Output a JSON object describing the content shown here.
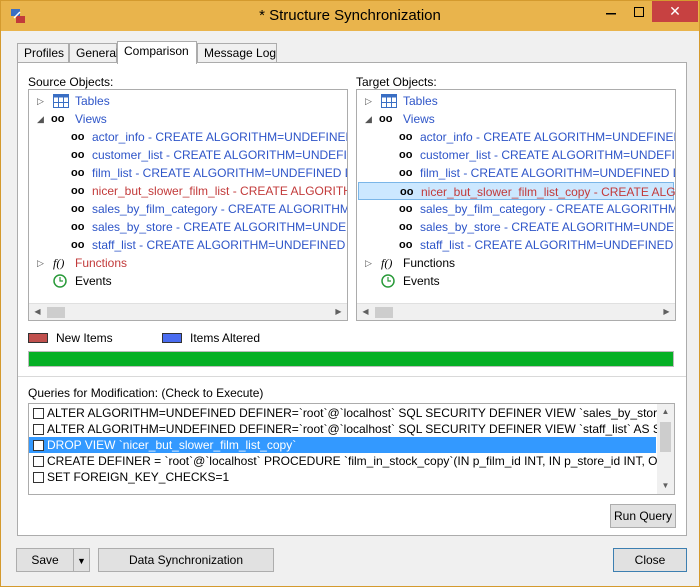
{
  "window": {
    "title": "* Structure Synchronization"
  },
  "tabs": [
    {
      "label": "Profiles"
    },
    {
      "label": "General"
    },
    {
      "label": "Comparison"
    },
    {
      "label": "Message Log"
    }
  ],
  "source": {
    "label": "Source Objects:",
    "tables": "Tables",
    "views": "Views",
    "items": [
      "actor_info - CREATE ALGORITHM=UNDEFINED DEFINER",
      "customer_list - CREATE ALGORITHM=UNDEFINED DEFINER",
      "film_list - CREATE ALGORITHM=UNDEFINED DEFINER",
      "nicer_but_slower_film_list - CREATE ALGORITHM=UNDEFINED",
      "sales_by_film_category - CREATE ALGORITHM=UNDEFINED",
      "sales_by_store - CREATE ALGORITHM=UNDEFINED DEFINER",
      "staff_list - CREATE ALGORITHM=UNDEFINED DEFINER"
    ],
    "functions": "Functions",
    "events": "Events"
  },
  "target": {
    "label": "Target Objects:",
    "tables": "Tables",
    "views": "Views",
    "items": [
      "actor_info - CREATE ALGORITHM=UNDEFINED DEFINER",
      "customer_list - CREATE ALGORITHM=UNDEFINED DEFINER",
      "film_list - CREATE ALGORITHM=UNDEFINED DEFINER",
      "nicer_but_slower_film_list_copy - CREATE ALGORITHM",
      "sales_by_film_category - CREATE ALGORITHM=UNDEFINED",
      "sales_by_store - CREATE ALGORITHM=UNDEFINED DEFINER",
      "staff_list - CREATE ALGORITHM=UNDEFINED DEFINER"
    ],
    "functions": "Functions",
    "events": "Events"
  },
  "legend": {
    "new_items": "New Items",
    "items_altered": "Items Altered",
    "new_color": "#c0504d",
    "altered_color": "#4a6cf0"
  },
  "progress": {
    "value": 1.0
  },
  "queries": {
    "label": "Queries for Modification: (Check to Execute)",
    "items": [
      "ALTER  ALGORITHM=UNDEFINED  DEFINER=`root`@`localhost`  SQL SECURITY DEFINER  VIEW `sales_by_store` AS  SELECT",
      "ALTER  ALGORITHM=UNDEFINED  DEFINER=`root`@`localhost`  SQL SECURITY DEFINER  VIEW `staff_list` AS  SELECT",
      "DROP VIEW `nicer_but_slower_film_list_copy`",
      "CREATE DEFINER = `root`@`localhost` PROCEDURE `film_in_stock_copy`(IN p_film_id INT, IN p_store_id INT, OUT p_film",
      "SET FOREIGN_KEY_CHECKS=1"
    ]
  },
  "buttons": {
    "run_query": "Run Query",
    "save": "Save",
    "data_sync": "Data Synchronization",
    "close": "Close"
  }
}
